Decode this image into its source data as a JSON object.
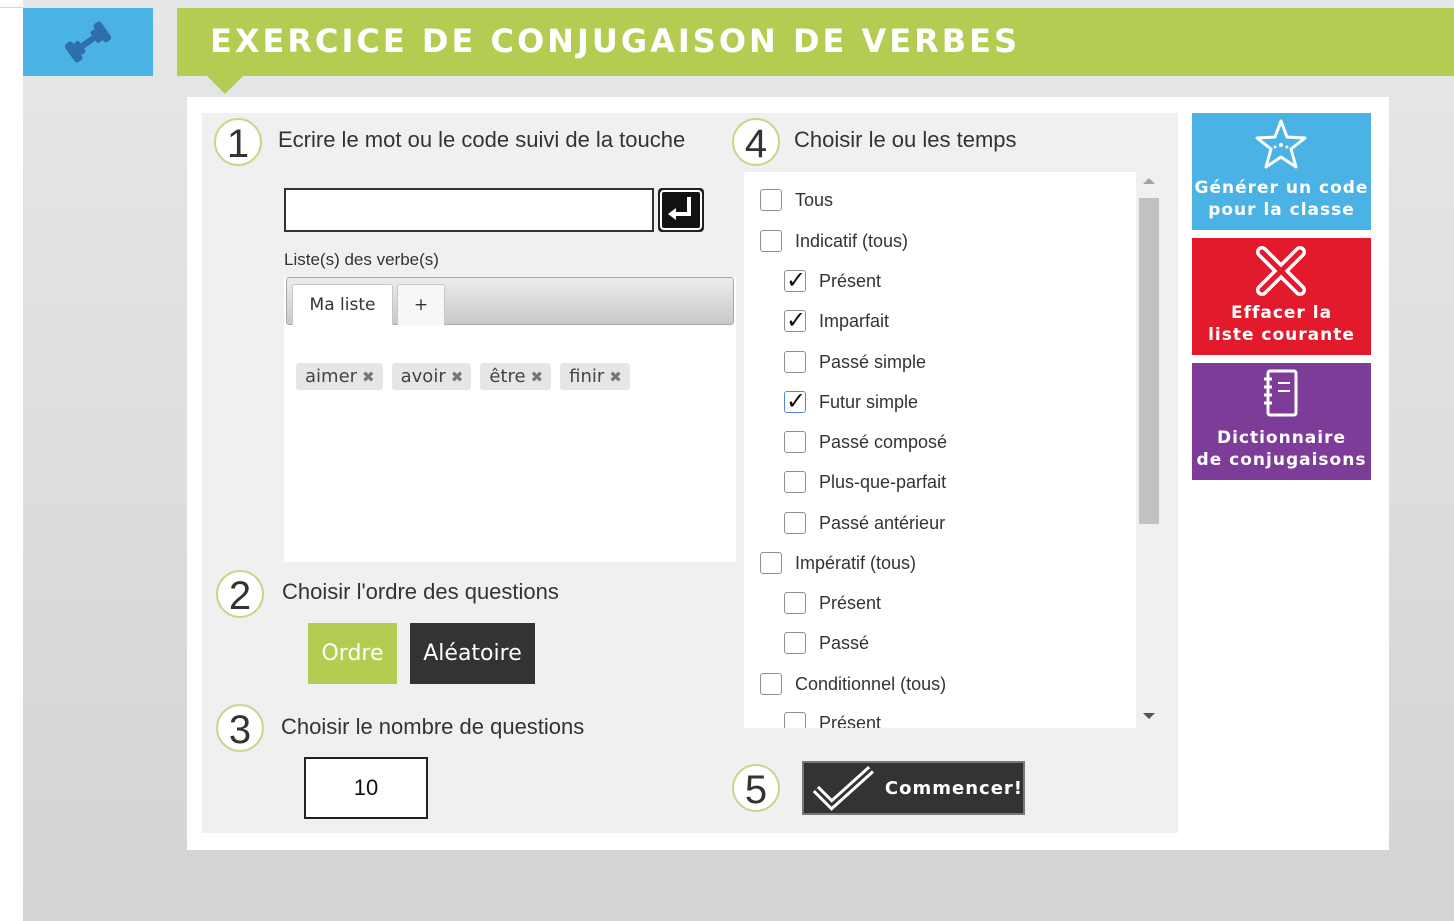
{
  "header": {
    "title": "EXERCICE DE CONJUGAISON DE VERBES",
    "logo_icon": "dumbbell-icon"
  },
  "step1": {
    "number": "1",
    "label": "Ecrire le mot ou le code suivi de la touche",
    "input_value": "",
    "enter_icon": "enter-key-icon",
    "list_label": "Liste(s) des verbe(s)",
    "tabs": [
      {
        "label": "Ma liste"
      },
      {
        "label": "+"
      }
    ],
    "verbs": [
      {
        "label": "aimer"
      },
      {
        "label": "avoir"
      },
      {
        "label": "être"
      },
      {
        "label": "finir"
      }
    ],
    "remove_glyph": "✖"
  },
  "step2": {
    "number": "2",
    "label": "Choisir l'ordre des questions",
    "order_label": "Ordre",
    "random_label": "Aléatoire"
  },
  "step3": {
    "number": "3",
    "label": "Choisir le nombre de questions",
    "count_value": "10"
  },
  "step4": {
    "number": "4",
    "label": "Choisir le ou les temps",
    "tenses": [
      {
        "label": "Tous",
        "checked": false,
        "indent": false
      },
      {
        "label": "Indicatif (tous)",
        "checked": false,
        "indent": false
      },
      {
        "label": "Présent",
        "checked": true,
        "indent": true
      },
      {
        "label": "Imparfait",
        "checked": true,
        "indent": true
      },
      {
        "label": "Passé simple",
        "checked": false,
        "indent": true
      },
      {
        "label": "Futur simple",
        "checked": true,
        "indent": true
      },
      {
        "label": "Passé composé",
        "checked": false,
        "indent": true
      },
      {
        "label": "Plus-que-parfait",
        "checked": false,
        "indent": true
      },
      {
        "label": "Passé antérieur",
        "checked": false,
        "indent": true
      },
      {
        "label": "Impératif (tous)",
        "checked": false,
        "indent": false
      },
      {
        "label": "Présent",
        "checked": false,
        "indent": true
      },
      {
        "label": "Passé",
        "checked": false,
        "indent": true
      },
      {
        "label": "Conditionnel (tous)",
        "checked": false,
        "indent": false
      },
      {
        "label": "Présent",
        "checked": false,
        "indent": true
      }
    ]
  },
  "step5": {
    "number": "5",
    "start_label": "Commencer!"
  },
  "side_buttons": [
    {
      "line1": "Générer un code",
      "line2": "pour la classe",
      "color": "#4bb2e6",
      "icon": "starfish-icon"
    },
    {
      "line1": "Effacer la",
      "line2": "liste courante",
      "color": "#e3192c",
      "icon": "cross-icon"
    },
    {
      "line1": "Dictionnaire",
      "line2": "de conjugaisons",
      "color": "#7d3c98",
      "icon": "notebook-icon"
    }
  ],
  "colors": {
    "accent_green": "#b5cc52",
    "dark": "#333333",
    "blue": "#4bb2e6"
  }
}
